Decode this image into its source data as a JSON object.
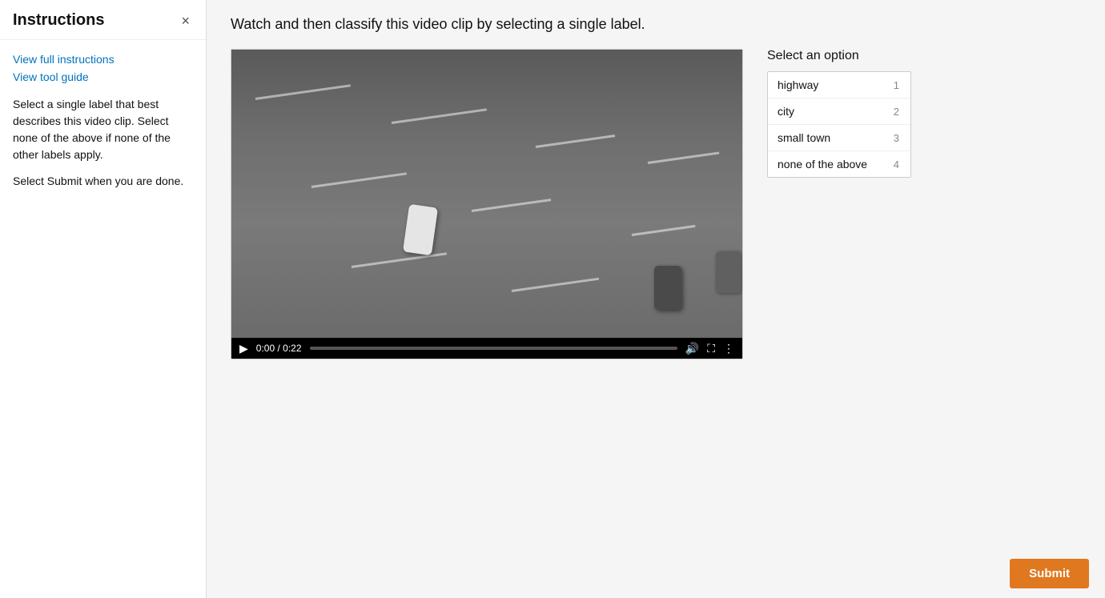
{
  "sidebar": {
    "title": "Instructions",
    "close_label": "×",
    "view_full_instructions": "View full instructions",
    "view_tool_guide": "View tool guide",
    "instruction_text_1": "Select a single label that best describes this video clip. Select none of the above if none of the other labels apply.",
    "instruction_text_2": "Select Submit when you are done."
  },
  "main": {
    "question": "Watch and then classify this video clip by selecting a single label.",
    "options_title": "Select an option",
    "options": [
      {
        "label": "highway",
        "number": "1"
      },
      {
        "label": "city",
        "number": "2"
      },
      {
        "label": "small town",
        "number": "3"
      },
      {
        "label": "none of the above",
        "number": "4"
      }
    ],
    "video": {
      "current_time": "0:00",
      "duration": "0:22",
      "time_display": "0:00 / 0:22"
    }
  },
  "footer": {
    "submit_label": "Submit"
  },
  "icons": {
    "close": "×",
    "play": "▶",
    "volume": "🔊",
    "fullscreen": "⛶",
    "more": "⋮"
  }
}
